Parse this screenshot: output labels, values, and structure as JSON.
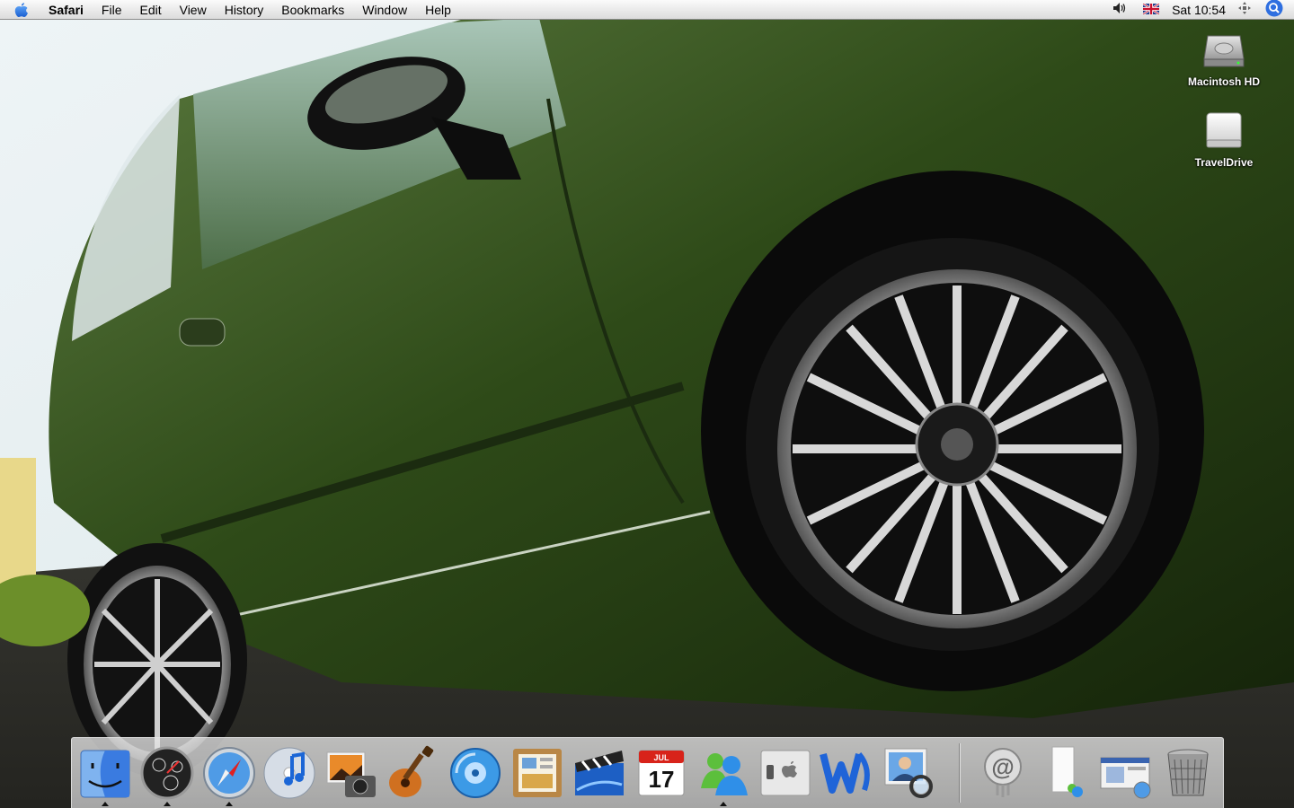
{
  "menubar": {
    "app_name": "Safari",
    "menus": [
      "File",
      "Edit",
      "View",
      "History",
      "Bookmarks",
      "Window",
      "Help"
    ],
    "clock": "Sat 10:54",
    "status_icons": [
      "volume-icon",
      "uk-flag-icon",
      "spaces-icon",
      "spotlight-icon"
    ]
  },
  "desktop": {
    "icons": [
      {
        "label": "Macintosh HD",
        "icon": "hard-drive-icon"
      },
      {
        "label": "TravelDrive",
        "icon": "external-drive-icon"
      }
    ]
  },
  "dock": {
    "apps": [
      {
        "name": "finder",
        "icon": "finder-icon",
        "running": true
      },
      {
        "name": "dashboard",
        "icon": "dashboard-icon",
        "running": true
      },
      {
        "name": "safari",
        "icon": "safari-icon",
        "running": true
      },
      {
        "name": "itunes",
        "icon": "itunes-icon",
        "running": false
      },
      {
        "name": "iphoto",
        "icon": "iphoto-icon",
        "running": false
      },
      {
        "name": "garageband",
        "icon": "garageband-icon",
        "running": false
      },
      {
        "name": "idvd",
        "icon": "idvd-icon",
        "running": false
      },
      {
        "name": "iweb",
        "icon": "iweb-icon",
        "running": false
      },
      {
        "name": "imovie",
        "icon": "imovie-icon",
        "running": false
      },
      {
        "name": "ical",
        "icon": "ical-icon",
        "running": false
      },
      {
        "name": "messenger",
        "icon": "messenger-icon",
        "running": true
      },
      {
        "name": "bootcamp",
        "icon": "bootcamp-icon",
        "running": false
      },
      {
        "name": "word",
        "icon": "word-icon",
        "running": false
      },
      {
        "name": "preview",
        "icon": "preview-icon",
        "running": false
      }
    ],
    "ical_month": "JUL",
    "ical_day": "17",
    "others": [
      {
        "name": "mail-stack",
        "icon": "at-sign-icon"
      },
      {
        "name": "documents-stack",
        "icon": "documents-icon"
      },
      {
        "name": "downloads-stack",
        "icon": "downloads-icon"
      },
      {
        "name": "trash",
        "icon": "trash-icon"
      }
    ]
  }
}
